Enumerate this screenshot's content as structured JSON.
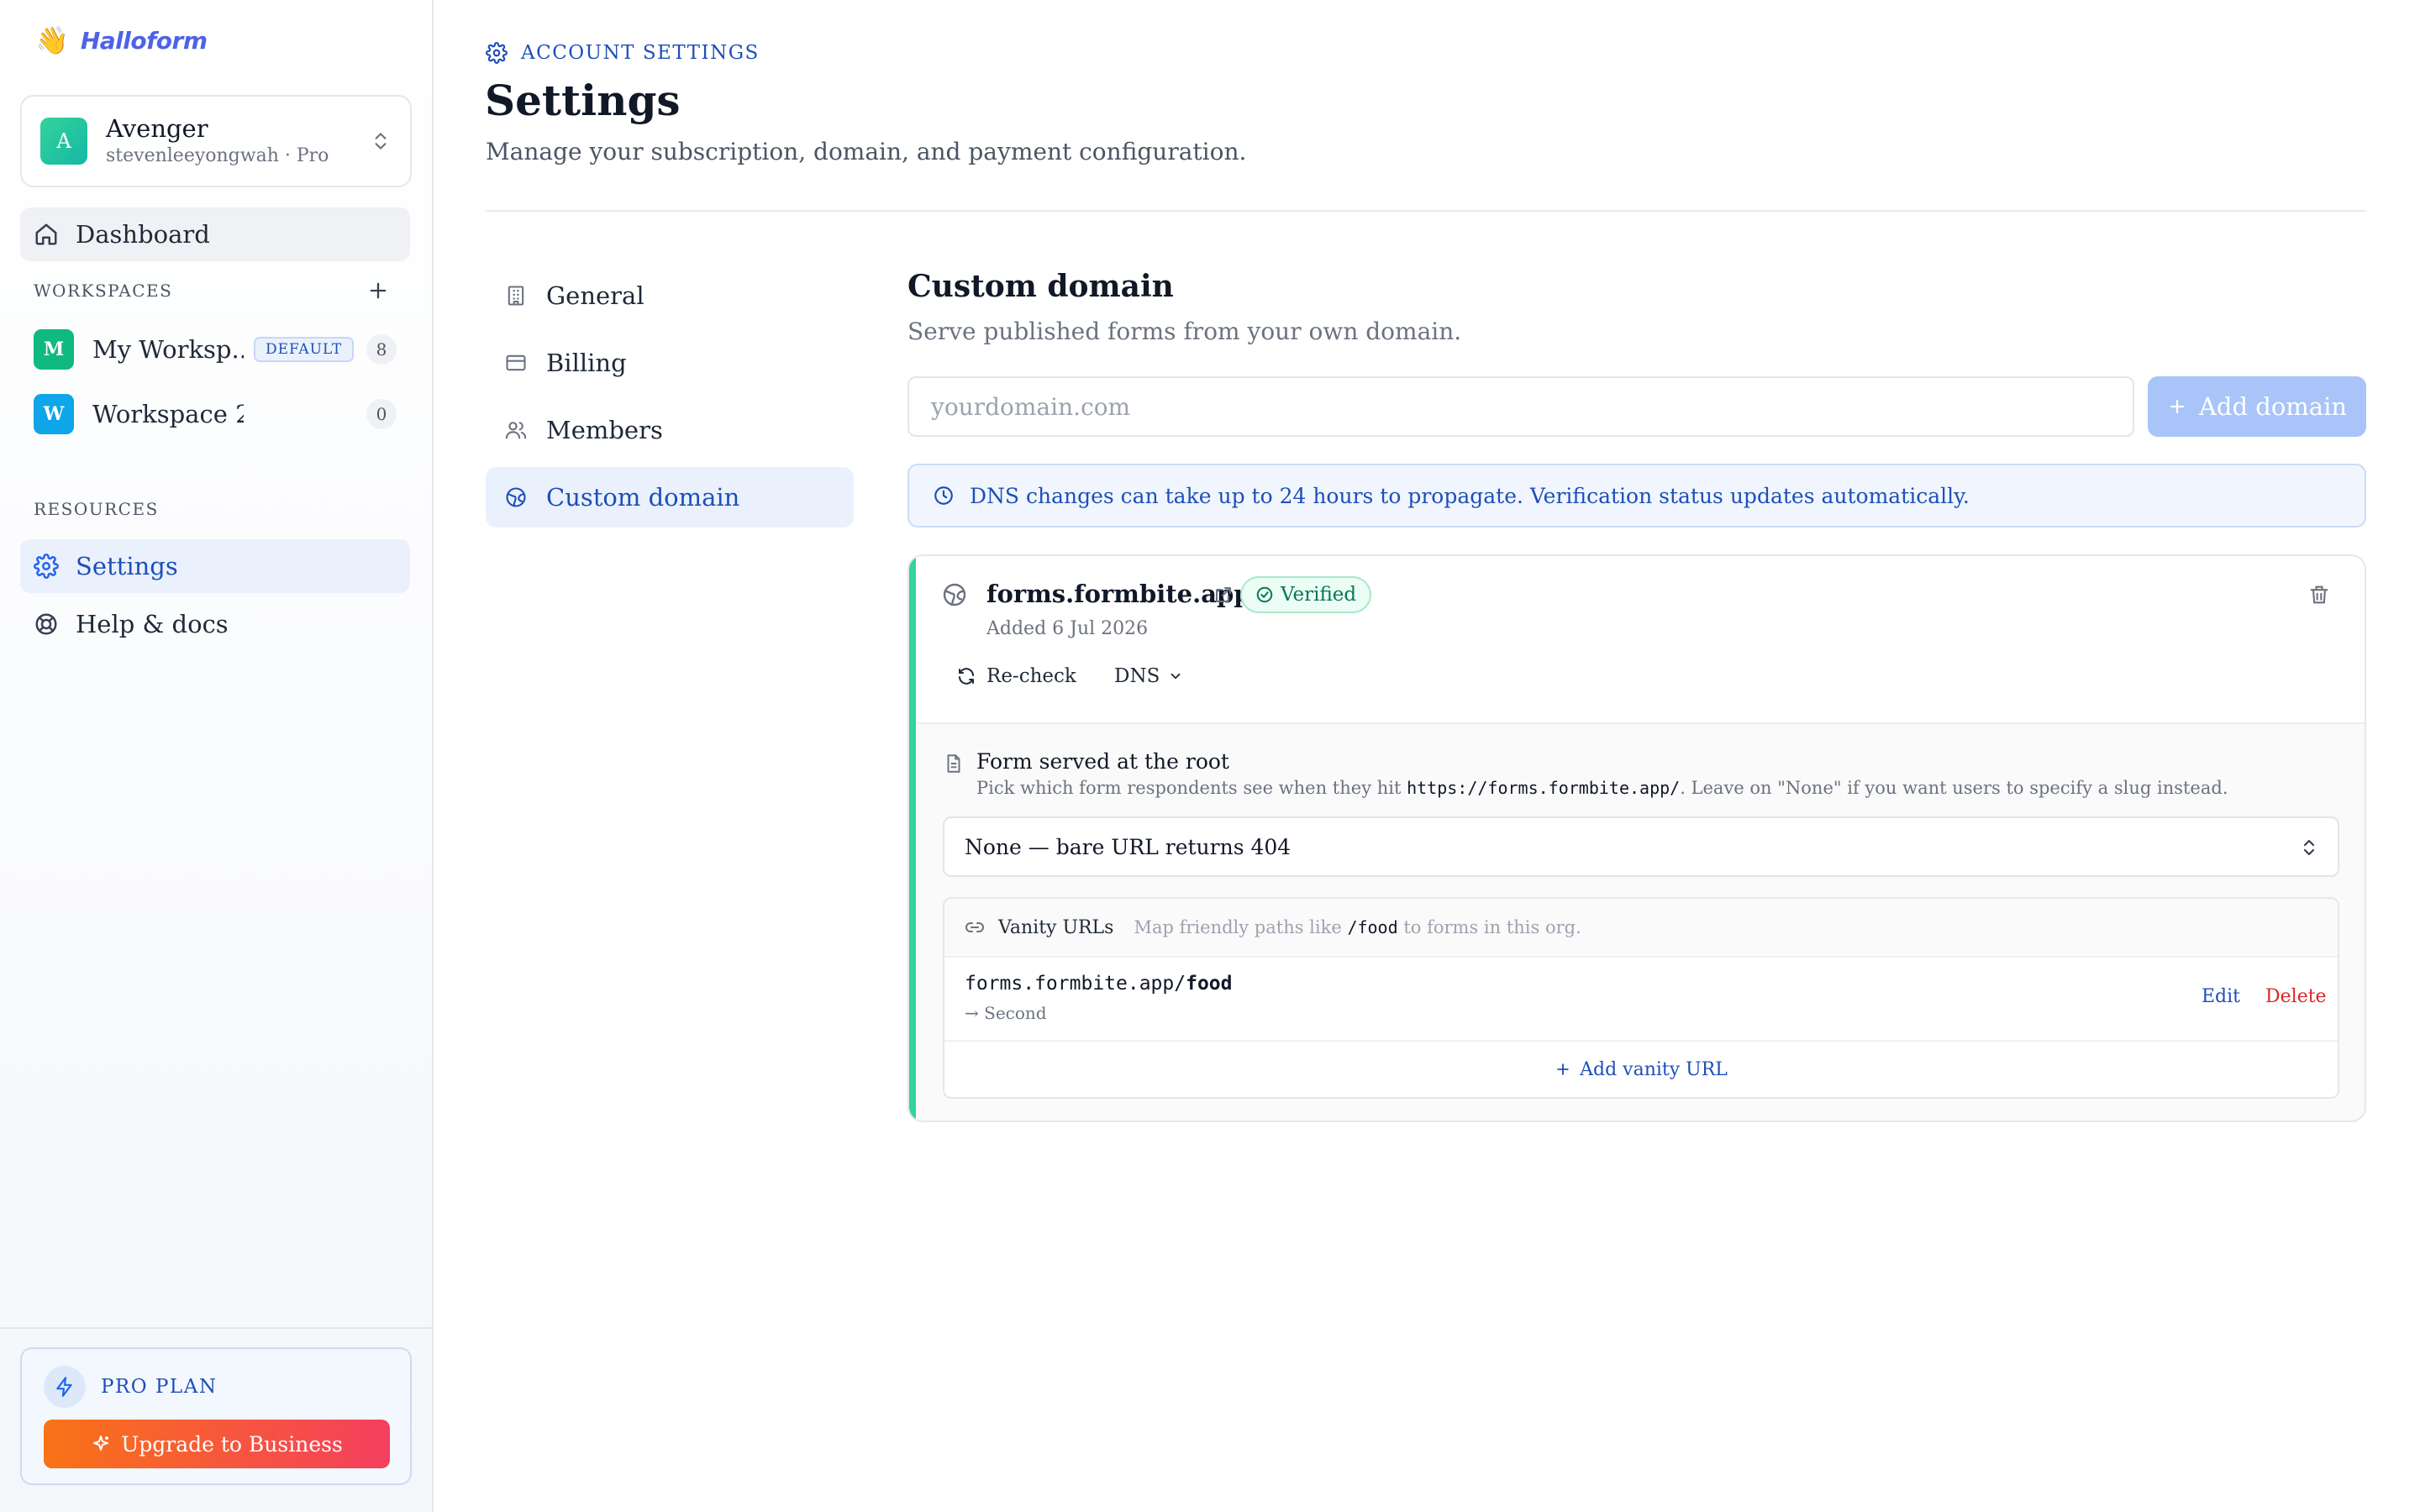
{
  "brand": {
    "logo_emoji": "👋",
    "name": "Halloform"
  },
  "org": {
    "avatar": "A",
    "name": "Avenger",
    "subtitle": "stevenleeyongwah · Pro"
  },
  "sidebar": {
    "dashboard_label": "Dashboard",
    "workspaces_label": "WORKSPACES",
    "workspaces": [
      {
        "initial": "M",
        "name": "My Worksp...",
        "badge": "DEFAULT",
        "count": "8",
        "color": "#10b981"
      },
      {
        "initial": "W",
        "name": "Workspace 2",
        "badge": "",
        "count": "0",
        "color": "#0ea5e9"
      }
    ],
    "resources_label": "RESOURCES",
    "settings_label": "Settings",
    "help_label": "Help & docs"
  },
  "plan": {
    "label": "PRO PLAN",
    "upgrade_label": "Upgrade to Business"
  },
  "header": {
    "eyebrow": "ACCOUNT SETTINGS",
    "title": "Settings",
    "description": "Manage your subscription, domain, and payment configuration."
  },
  "settings_nav": {
    "general": "General",
    "billing": "Billing",
    "members": "Members",
    "custom_domain": "Custom domain",
    "active": "custom_domain"
  },
  "custom_domain": {
    "title": "Custom domain",
    "description": "Serve published forms from your own domain.",
    "input_placeholder": "yourdomain.com",
    "input_value": "",
    "add_button": "Add domain",
    "info": "DNS changes can take up to 24 hours to propagate. Verification status updates automatically.",
    "domain": {
      "host": "forms.formbite.app",
      "status": "Verified",
      "added": "Added 6 Jul 2026",
      "recheck": "Re-check",
      "dns": "DNS",
      "root_title": "Form served at the root",
      "root_desc_pre": "Pick which form respondents see when they hit ",
      "root_desc_code": "https://forms.formbite.app/",
      "root_desc_post": ". Leave on \"None\" if you want users to specify a slug instead.",
      "root_select": "None — bare URL returns 404",
      "vanity": {
        "title": "Vanity URLs",
        "desc_pre": "Map friendly paths like ",
        "desc_code": "/food",
        "desc_post": " to forms in this org.",
        "rows": [
          {
            "base": "forms.formbite.app/",
            "path": "food",
            "target": "→ Second",
            "edit": "Edit",
            "delete": "Delete"
          }
        ],
        "add_label": "Add vanity URL"
      }
    }
  },
  "colors": {
    "accent": "#2563eb",
    "accent_text": "#1d4fb8",
    "success": "#34d399",
    "danger": "#dc2626",
    "upgrade_gradient": [
      "#f97316",
      "#f43f5e"
    ]
  }
}
